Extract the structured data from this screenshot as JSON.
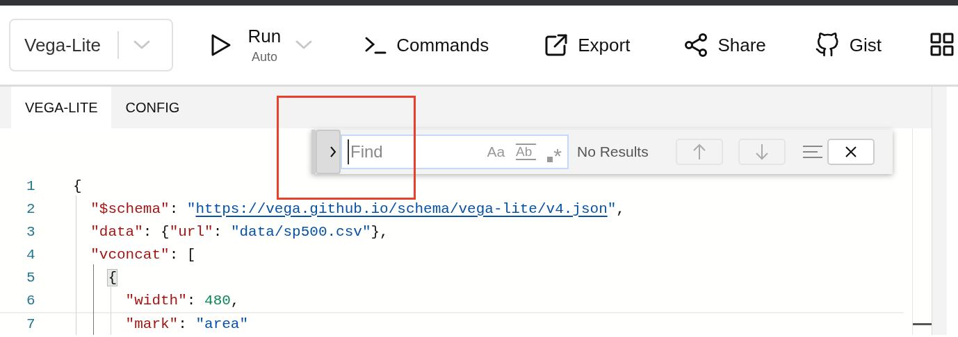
{
  "toolbar": {
    "mode_select": {
      "value": "Vega-Lite"
    },
    "run": {
      "label": "Run",
      "sublabel": "Auto"
    },
    "buttons": [
      {
        "kind": "commands",
        "label": "Commands"
      },
      {
        "kind": "export",
        "label": "Export"
      },
      {
        "kind": "share",
        "label": "Share"
      },
      {
        "kind": "gist",
        "label": "Gist"
      },
      {
        "kind": "grid"
      }
    ]
  },
  "tabs": [
    {
      "label": "VEGA-LITE",
      "selected": true
    },
    {
      "label": "CONFIG",
      "selected": false
    }
  ],
  "find_widget": {
    "placeholder": "Find",
    "options": [
      {
        "kind": "case",
        "label": "Aa"
      },
      {
        "kind": "word",
        "label": "Ab"
      },
      {
        "kind": "regex",
        "label": "*"
      }
    ],
    "status": "No Results"
  },
  "editor": {
    "lines": [
      {
        "number": "1",
        "tokens": [
          {
            "kind": "punct",
            "text": "{"
          }
        ]
      },
      {
        "number": "2",
        "tokens": [
          {
            "kind": "key",
            "text": "  \"$schema\""
          },
          {
            "kind": "punct",
            "text": ": "
          },
          {
            "kind": "string",
            "text": "\""
          },
          {
            "kind": "link",
            "text": "https://vega.github.io/schema/vega-lite/v4.json"
          },
          {
            "kind": "string",
            "text": "\""
          },
          {
            "kind": "punct",
            "text": ","
          }
        ]
      },
      {
        "number": "3",
        "tokens": [
          {
            "kind": "key",
            "text": "  \"data\""
          },
          {
            "kind": "punct",
            "text": ": {"
          },
          {
            "kind": "key",
            "text": "\"url\""
          },
          {
            "kind": "punct",
            "text": ": "
          },
          {
            "kind": "string",
            "text": "\"data/sp500.csv\""
          },
          {
            "kind": "punct",
            "text": "},"
          }
        ]
      },
      {
        "number": "4",
        "tokens": [
          {
            "kind": "key",
            "text": "  \"vconcat\""
          },
          {
            "kind": "punct",
            "text": ": ["
          }
        ]
      },
      {
        "number": "5",
        "tokens": [
          {
            "kind": "bracket",
            "text": "    {"
          }
        ]
      },
      {
        "number": "6",
        "tokens": [
          {
            "kind": "key",
            "text": "      \"width\""
          },
          {
            "kind": "punct",
            "text": ": "
          },
          {
            "kind": "number",
            "text": "480"
          },
          {
            "kind": "punct",
            "text": ","
          }
        ]
      },
      {
        "number": "7",
        "current": true,
        "tokens": [
          {
            "kind": "key",
            "text": "      \"mark\""
          },
          {
            "kind": "punct",
            "text": ": "
          },
          {
            "kind": "string",
            "text": "\"area\""
          }
        ]
      }
    ]
  }
}
